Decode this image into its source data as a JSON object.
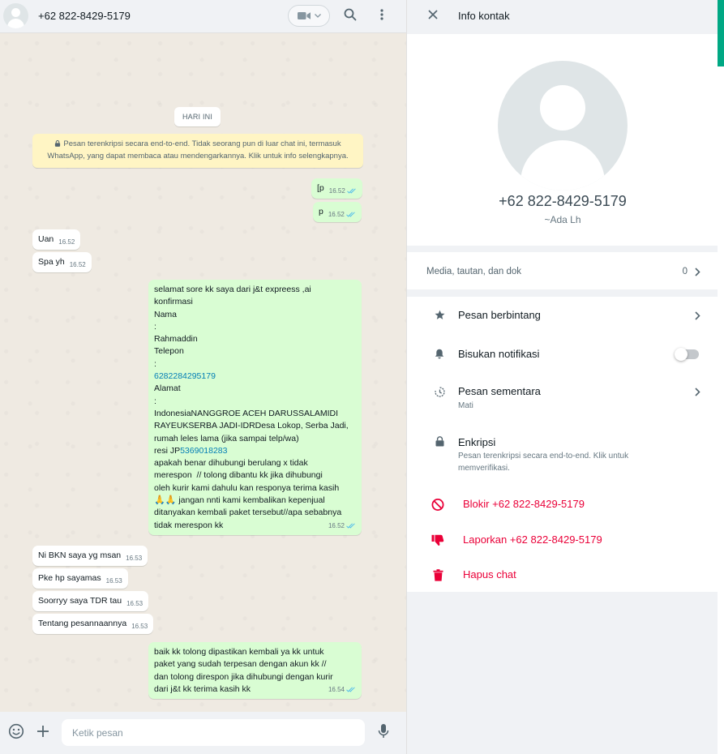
{
  "chat": {
    "contact_name": "+62 822-8429-5179",
    "date_chip": "HARI INI",
    "encryption_notice": "Pesan terenkripsi secara end-to-end. Tidak seorang pun di luar chat ini, termasuk WhatsApp, yang dapat membaca atau mendengarkannya. Klik untuk info selengkapnya.",
    "messages": [
      {
        "dir": "out",
        "text": "[p",
        "time": "16.52"
      },
      {
        "dir": "out",
        "text": "p",
        "time": "16.52"
      },
      {
        "dir": "in",
        "text": "Uan",
        "time": "16.52"
      },
      {
        "dir": "in",
        "text": "Spa yh",
        "time": "16.52"
      },
      {
        "dir": "out",
        "time": "16.52",
        "lines": [
          "selamat sore kk saya dari j&t expreess ,ai",
          "konfirmasi",
          "Nama",
          ":",
          "Rahmaddin",
          "Telepon",
          ":",
          "6282284295179",
          "Alamat",
          ":",
          "IndonesiaNANGGROE ACEH DARUSSALAMIDI",
          "RAYEUKSERBA JADI-IDRDesa Lokop, Serba Jadi,",
          "rumah leles lama (jika sampai telp/wa)",
          "resi JP",
          "5369018283",
          "apakah benar dihubungi berulang x tidak",
          "merespon  // tolong dibantu kk jika dihubungi",
          "oleh kurir kami dahulu kan responya terima kasih",
          "🙏🙏",
          " jangan nnti kami kembalikan kepenjual",
          "ditanyakan kembali paket tersebut//apa sebabnya",
          "tidak merespon kk"
        ]
      },
      {
        "dir": "in",
        "text": "Ni BKN saya yg msan",
        "time": "16.53"
      },
      {
        "dir": "in",
        "text": "Pke hp sayamas",
        "time": "16.53"
      },
      {
        "dir": "in",
        "text": "Soorryy saya TDR tau",
        "time": "16.53"
      },
      {
        "dir": "in",
        "text": "Tentang pesannaannya",
        "time": "16.53"
      },
      {
        "dir": "out",
        "time": "16.54",
        "lines": [
          "baik kk tolong dipastikan kembali ya kk untuk",
          "paket yang sudah terpesan dengan akun kk //",
          "dan tolong direspon jika dihubungi dengan kurir",
          "dari j&t kk terima kasih kk"
        ]
      }
    ],
    "composer_placeholder": "Ketik pesan"
  },
  "info": {
    "title": "Info kontak",
    "phone": "+62 822-8429-5179",
    "about": "~Ada Lh",
    "media_label": "Media, tautan, dan dok",
    "media_count": "0",
    "starred_label": "Pesan berbintang",
    "mute_label": "Bisukan notifikasi",
    "disappearing_label": "Pesan sementara",
    "disappearing_value": "Mati",
    "encryption_label": "Enkripsi",
    "encryption_sub": "Pesan terenkripsi secara end-to-end. Klik untuk memverifikasi.",
    "block_label": "Blokir +62 822-8429-5179",
    "report_label": "Laporkan +62 822-8429-5179",
    "delete_label": "Hapus chat",
    "mute_enabled": false
  },
  "colors": {
    "outgoing_bubble": "#d9fdd3",
    "incoming_bubble": "#ffffff",
    "danger": "#ea0038",
    "accent": "#00a884",
    "read_tick": "#53bdeb"
  },
  "icons": {
    "header": [
      "video-call-icon",
      "chevron-down-icon",
      "search-icon",
      "menu-icon"
    ],
    "composer": [
      "emoji-icon",
      "attach-plus-icon",
      "microphone-icon"
    ],
    "info": [
      "close-icon",
      "star-icon",
      "bell-icon",
      "timer-icon",
      "lock-icon",
      "block-icon",
      "thumbs-down-icon",
      "trash-icon",
      "chevron-right-icon"
    ]
  }
}
